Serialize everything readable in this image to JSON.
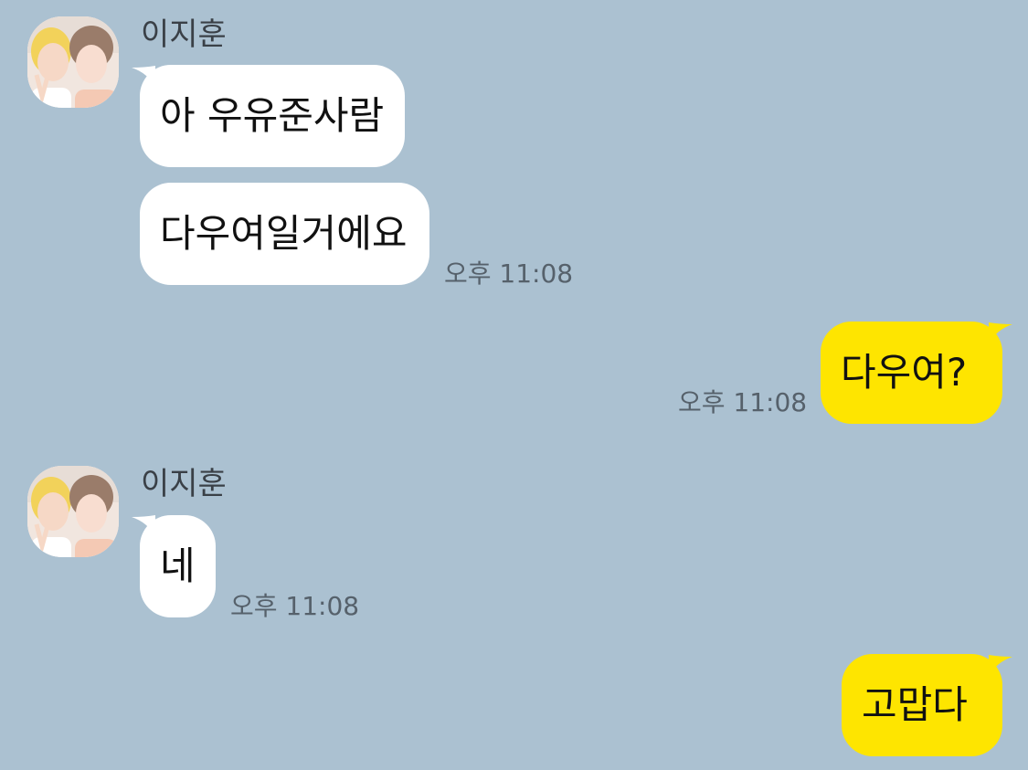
{
  "sender": {
    "name": "이지훈"
  },
  "colors": {
    "background": "#abc1d1",
    "incoming": "#ffffff",
    "outgoing": "#fee500"
  },
  "messages": [
    {
      "direction": "in",
      "text": "아 우유준사람"
    },
    {
      "direction": "in",
      "text": "다우여일거에요",
      "time": "오후 11:08"
    },
    {
      "direction": "out",
      "text": "다우여?",
      "time": "오후 11:08"
    },
    {
      "direction": "in",
      "text": "네",
      "time": "오후 11:08"
    },
    {
      "direction": "out",
      "text": "고맙다"
    }
  ]
}
